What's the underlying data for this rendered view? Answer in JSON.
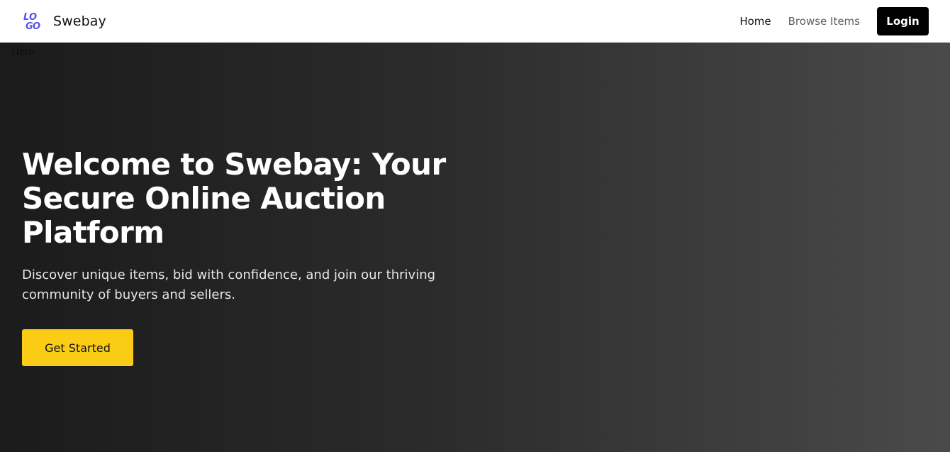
{
  "navbar": {
    "logo_text": "LOGO",
    "brand_name": "Swebay",
    "links": {
      "home": "Home",
      "browse": "Browse Items"
    },
    "login_label": "Login",
    "logo_color": "#5b4fe9"
  },
  "hero": {
    "image_alt": "Hero",
    "title": "Welcome to Swebay: Your Secure Online Auction Platform",
    "subtitle": "Discover unique items, bid with confidence, and join our thriving community of buyers and sellers.",
    "cta_label": "Get Started",
    "cta_color": "#facc15"
  }
}
